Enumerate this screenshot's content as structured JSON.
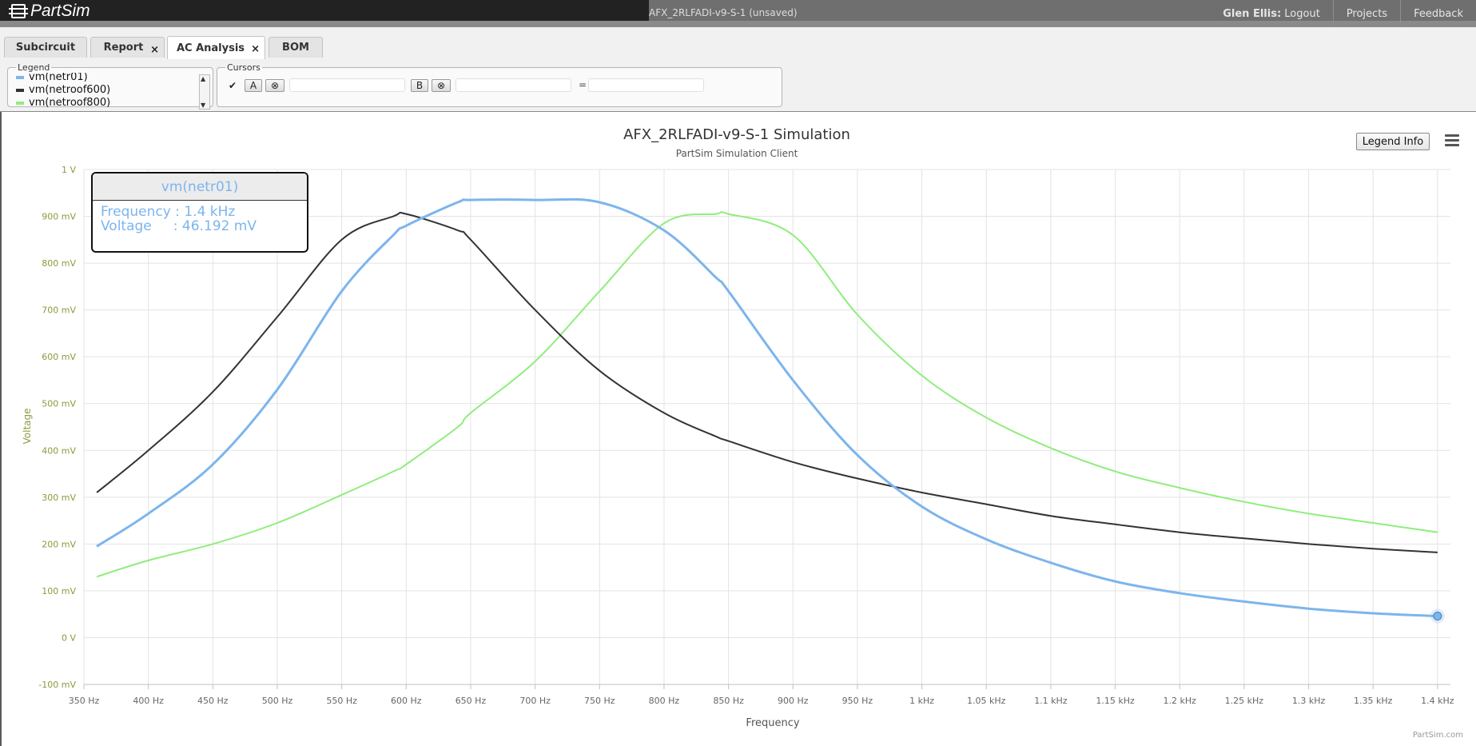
{
  "app": {
    "brand": "PartSim",
    "document_title": "AFX_2RLFADI-v9-S-1 (unsaved)",
    "user_name": "Glen Ellis:",
    "logout": "Logout",
    "nav_projects": "Projects",
    "nav_feedback": "Feedback"
  },
  "tabs": [
    {
      "label": "Subcircuit",
      "closable": false,
      "active": false
    },
    {
      "label": "Report",
      "closable": true,
      "active": false
    },
    {
      "label": "AC Analysis",
      "closable": true,
      "active": true
    },
    {
      "label": "BOM",
      "closable": false,
      "active": false
    }
  ],
  "close_glyph": "×",
  "legend_panel": {
    "title": "Legend",
    "items": [
      {
        "label": "vm(netr01)",
        "color": "#7cb5ec"
      },
      {
        "label": "vm(netroof600)",
        "color": "#333333"
      },
      {
        "label": "vm(netroof800)",
        "color": "#90ed7d"
      }
    ]
  },
  "cursors_panel": {
    "title": "Cursors",
    "checkbox": "✔",
    "cursor_a": "A",
    "cursor_b": "B",
    "clear_glyph": "⊗",
    "equals": "=",
    "input_a": "",
    "input_b": "",
    "input_diff": ""
  },
  "legend_info_button": "Legend Info",
  "tooltip": {
    "series": "vm(netr01)",
    "frequency_line": "Frequency : 1.4 kHz",
    "voltage_line": "Voltage     : 46.192 mV"
  },
  "credit": "PartSim.com",
  "chart_data": {
    "type": "line",
    "title": "AFX_2RLFADI-v9-S-1 Simulation",
    "subtitle": "PartSim Simulation Client",
    "xlabel": "Frequency",
    "ylabel": "Voltage",
    "xlim": [
      350,
      1410
    ],
    "ylim": [
      -100,
      1000
    ],
    "x_ticks": [
      350,
      400,
      450,
      500,
      550,
      600,
      650,
      700,
      750,
      800,
      850,
      900,
      950,
      1000,
      1050,
      1100,
      1150,
      1200,
      1250,
      1300,
      1350,
      1400
    ],
    "x_tick_labels": [
      "350 Hz",
      "400 Hz",
      "450 Hz",
      "500 Hz",
      "550 Hz",
      "600 Hz",
      "650 Hz",
      "700 Hz",
      "750 Hz",
      "800 Hz",
      "850 Hz",
      "900 Hz",
      "950 Hz",
      "1 kHz",
      "1.05 kHz",
      "1.1 kHz",
      "1.15 kHz",
      "1.2 kHz",
      "1.25 kHz",
      "1.3 kHz",
      "1.35 kHz",
      "1.4 kHz"
    ],
    "y_ticks": [
      -100,
      0,
      100,
      200,
      300,
      400,
      500,
      600,
      700,
      800,
      900,
      1000
    ],
    "y_tick_labels": [
      "-100 mV",
      "0 V",
      "100 mV",
      "200 mV",
      "300 mV",
      "400 mV",
      "500 mV",
      "600 mV",
      "700 mV",
      "800 mV",
      "900 mV",
      "1 V"
    ],
    "grid": true,
    "x": [
      360,
      400,
      450,
      500,
      550,
      590,
      600,
      640,
      650,
      700,
      750,
      800,
      840,
      850,
      900,
      950,
      1000,
      1050,
      1100,
      1150,
      1200,
      1250,
      1300,
      1350,
      1400
    ],
    "series": [
      {
        "name": "vm(netr01)",
        "color": "#7cb5ec",
        "values": [
          195,
          265,
          370,
          530,
          740,
          860,
          880,
          930,
          935,
          935,
          930,
          870,
          770,
          740,
          550,
          390,
          280,
          210,
          160,
          120,
          95,
          77,
          62,
          52,
          46
        ]
      },
      {
        "name": "vm(netroof600)",
        "color": "#333333",
        "values": [
          310,
          400,
          525,
          685,
          850,
          900,
          905,
          870,
          850,
          700,
          570,
          480,
          430,
          420,
          375,
          340,
          310,
          285,
          260,
          242,
          225,
          212,
          200,
          190,
          182
        ]
      },
      {
        "name": "vm(netroof800)",
        "color": "#90ed7d",
        "values": [
          130,
          165,
          200,
          245,
          305,
          355,
          370,
          450,
          480,
          590,
          740,
          885,
          905,
          905,
          860,
          690,
          560,
          470,
          405,
          355,
          320,
          290,
          265,
          245,
          225
        ]
      }
    ],
    "marker": {
      "series": "vm(netr01)",
      "x": 1400,
      "y": 46
    }
  }
}
